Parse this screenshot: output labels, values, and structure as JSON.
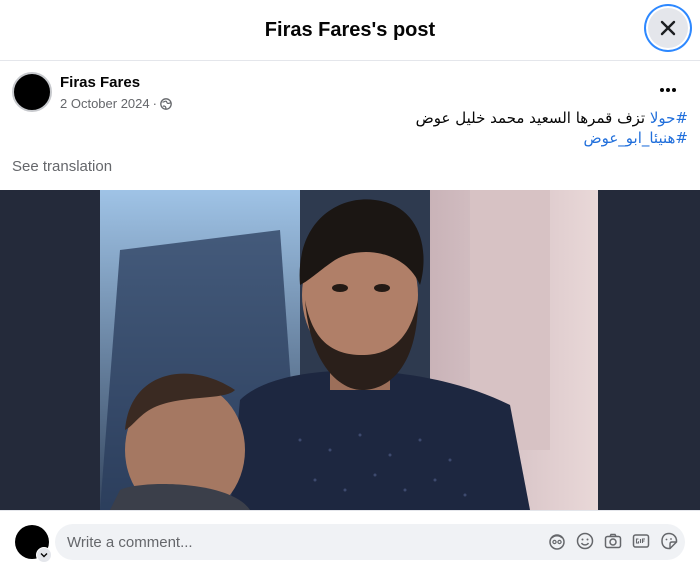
{
  "header": {
    "title": "Firas Fares's post"
  },
  "post": {
    "author": "Firas Fares",
    "date": "2 October 2024",
    "separator": "·",
    "line1_hashtag": "#حولا",
    "line1_text": " تزف قمرها السعيد محمد خليل عوض",
    "line2_hashtag": "#هنيئا_ابو_عوض",
    "see_translation": "See translation"
  },
  "comment": {
    "placeholder": "Write a comment..."
  },
  "icons": {
    "close": "close-icon",
    "more": "more-icon",
    "audience": "globe-icon",
    "avatar_switch": "chevron-down-icon",
    "comment_tools": [
      "avatar-sticker-icon",
      "emoji-icon",
      "camera-icon",
      "gif-icon",
      "sticker-icon"
    ]
  },
  "colors": {
    "accent": "#216fdb",
    "focus_ring": "#2d88ff",
    "photo_backdrop": "#242a3a"
  }
}
